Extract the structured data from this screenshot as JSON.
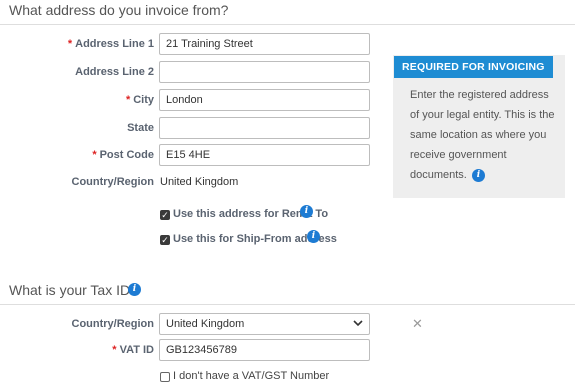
{
  "invoice_section": {
    "title": "What address do you invoice from?",
    "fields": {
      "address1": {
        "label": "Address Line 1",
        "required": "*",
        "value": "21 Training Street"
      },
      "address2": {
        "label": "Address Line 2",
        "value": ""
      },
      "city": {
        "label": "City",
        "required": "*",
        "value": "London"
      },
      "state": {
        "label": "State",
        "value": ""
      },
      "postcode": {
        "label": "Post Code",
        "required": "*",
        "value": "E15 4HE"
      },
      "country": {
        "label": "Country/Region",
        "value": "United Kingdom"
      }
    },
    "checkboxes": {
      "remit_to": {
        "label": "Use this address for Remit To",
        "checked": true
      },
      "ship_from": {
        "label": "Use this for Ship-From address",
        "checked": true
      }
    },
    "info_panel": {
      "badge": "REQUIRED FOR INVOICING",
      "text": "Enter the registered address of your legal entity. This is the same location as where you receive government documents."
    }
  },
  "tax_section": {
    "title": "What is your Tax ID?",
    "country": {
      "label": "Country/Region",
      "value": "United Kingdom"
    },
    "vat": {
      "label": "VAT ID",
      "required": "*",
      "value": "GB123456789"
    },
    "no_vat_checkbox": {
      "label": "I don't have a VAT/GST Number",
      "checked": false
    }
  },
  "icons": {
    "info": "info-icon",
    "check": "checkmark",
    "chevron": "chevron-down-icon",
    "clear": "close-icon"
  },
  "colors": {
    "accent": "#1e8cd3",
    "required": "#dd2222",
    "panel_bg": "#eeeeee"
  }
}
